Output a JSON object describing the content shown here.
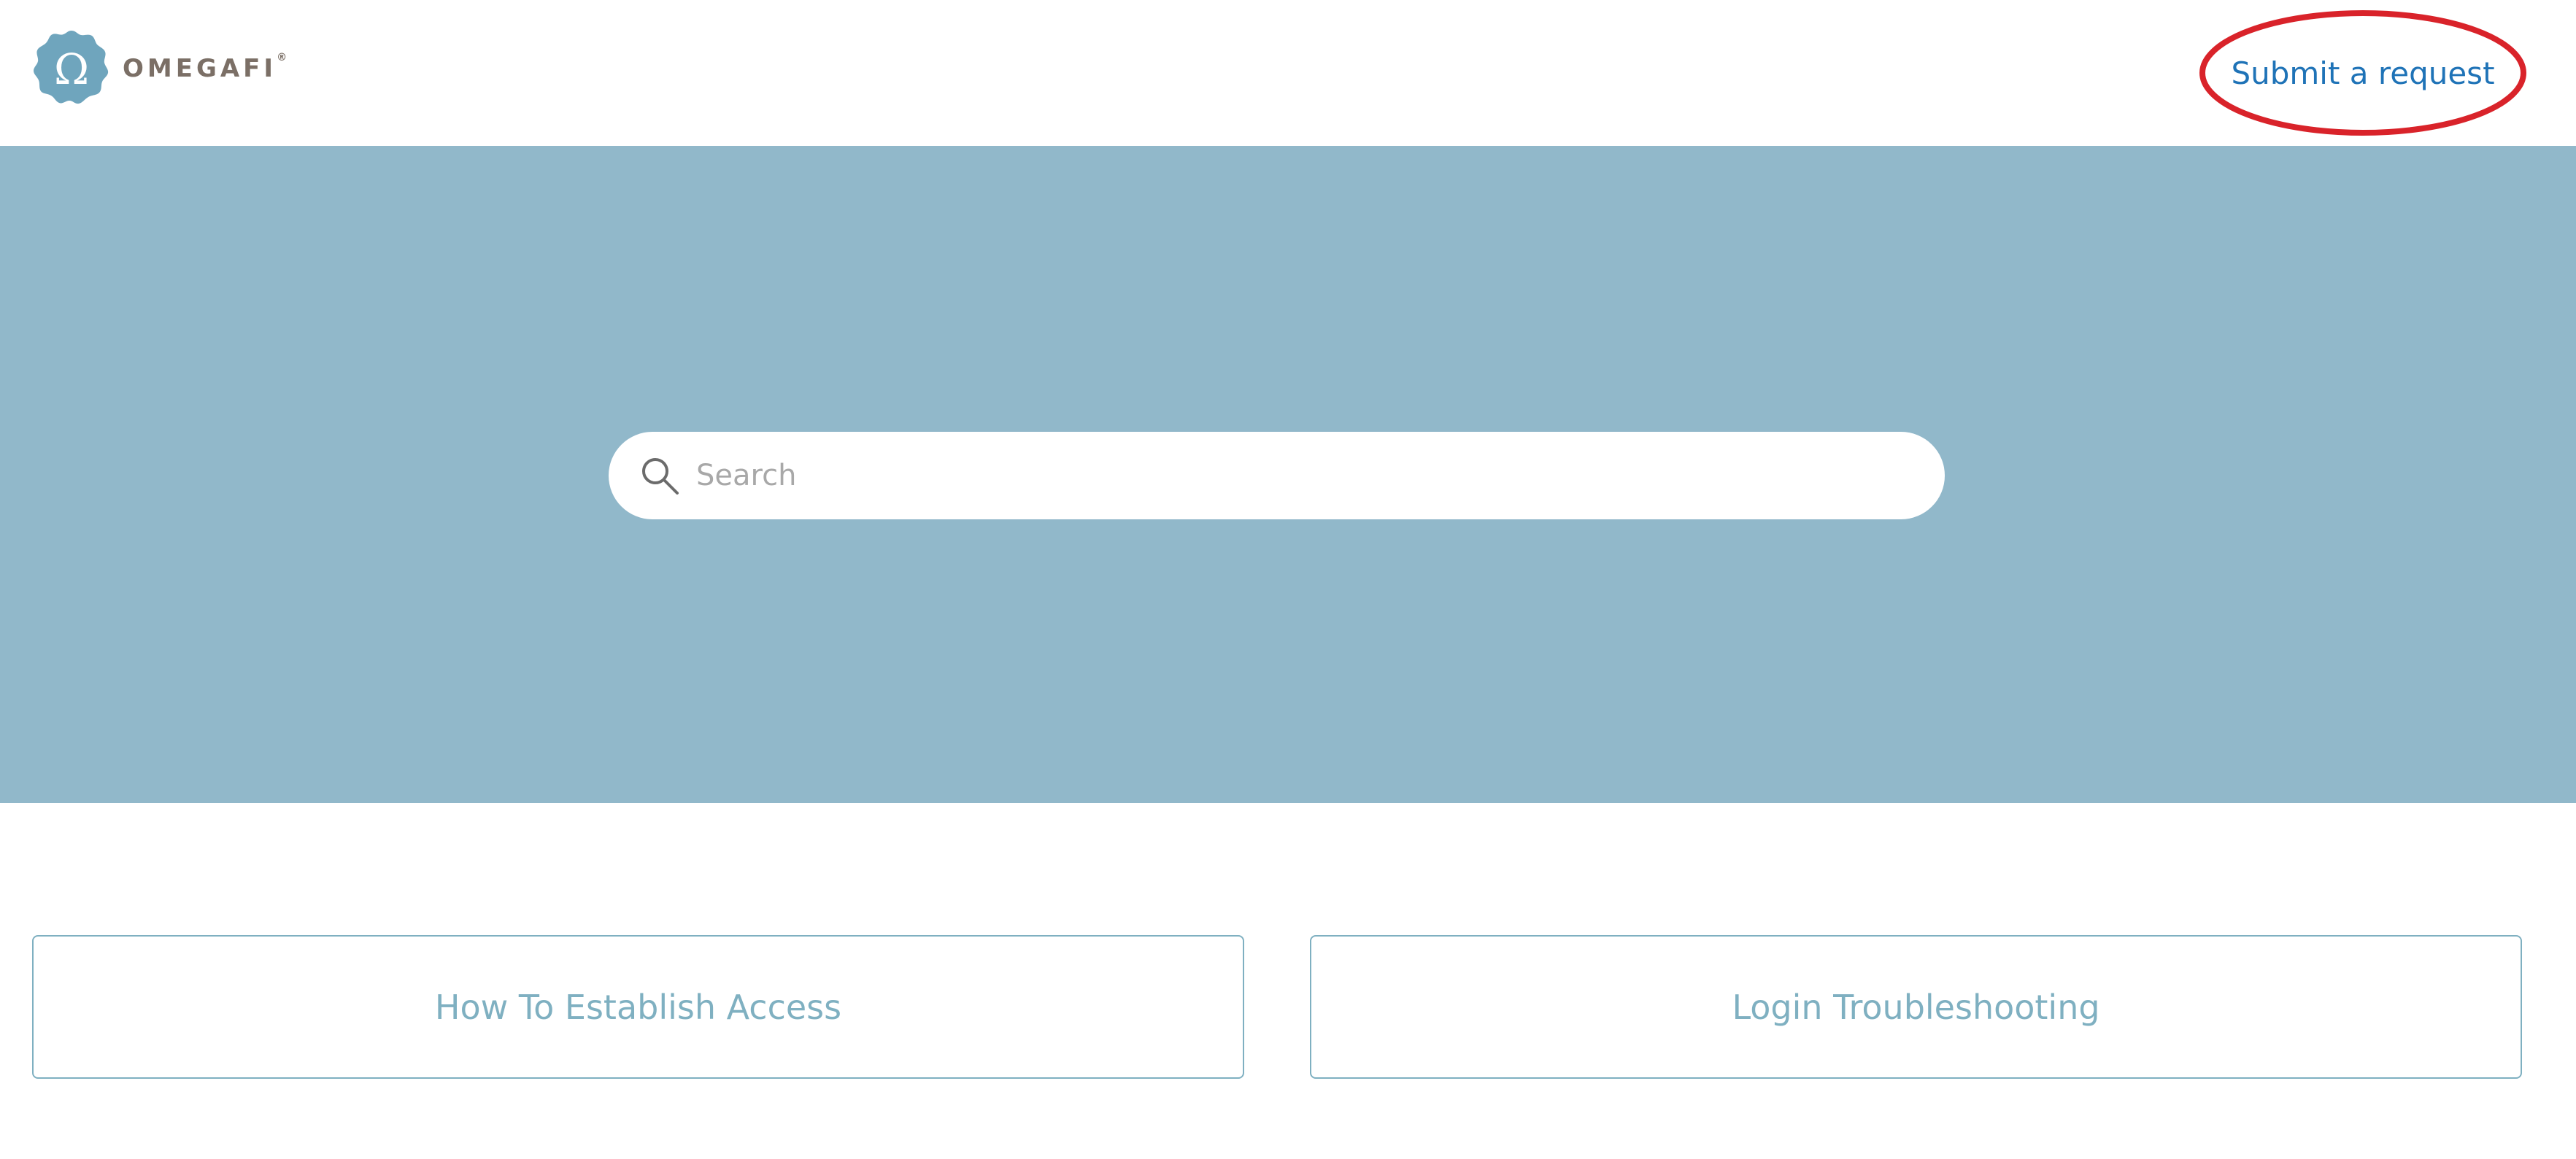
{
  "header": {
    "logo": {
      "wordmark": "OMEGAFI",
      "registered_mark": "®",
      "icon": "omega-seal-icon"
    },
    "submit_request_label": "Submit a request",
    "annotation_color": "#d9232a"
  },
  "hero": {
    "background_color": "#91b8ca",
    "search": {
      "placeholder": "Search",
      "value": "",
      "icon": "search-icon"
    }
  },
  "categories": [
    {
      "label": "How To Establish Access"
    },
    {
      "label": "Login Troubleshooting"
    }
  ],
  "colors": {
    "link": "#1f73b7",
    "card_border": "#7fb0c1",
    "logo_badge": "#6fa5bd",
    "logo_text": "#7b6f66"
  }
}
